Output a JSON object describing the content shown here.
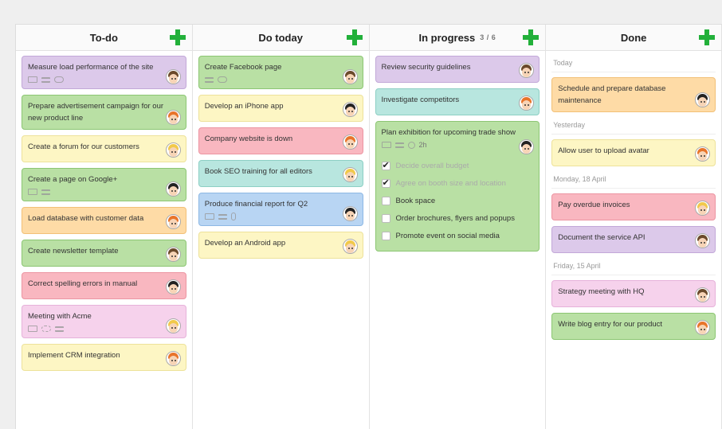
{
  "columns": [
    {
      "title": "To-do",
      "count": "",
      "cards": [
        {
          "title": "Measure load performance of the site",
          "color": "purple",
          "meta": [
            "note-icon",
            "checklist-icon",
            "comment-icon"
          ],
          "hair": "#6b4a2b"
        },
        {
          "title": "Prepare advertisement campaign for our new product line",
          "color": "green",
          "meta": [],
          "hair": "#e8742a"
        },
        {
          "title": "Create a forum for our customers",
          "color": "yellow",
          "meta": [],
          "hair": "#f1c94a"
        },
        {
          "title": "Create a page on Google+",
          "color": "green",
          "meta": [
            "note-icon",
            "checklist-icon"
          ],
          "hair": "#222222"
        },
        {
          "title": "Load database with customer data",
          "color": "orange",
          "meta": [],
          "hair": "#e8742a"
        },
        {
          "title": "Create newsletter template",
          "color": "green",
          "meta": [],
          "hair": "#6b4a2b"
        },
        {
          "title": "Correct spelling errors in manual",
          "color": "red",
          "meta": [],
          "hair": "#222222"
        },
        {
          "title": "Meeting with Acme",
          "color": "pink",
          "meta": [
            "note-icon",
            "repeat-icon",
            "checklist-icon"
          ],
          "hair": "#f1c94a"
        },
        {
          "title": "Implement CRM integration",
          "color": "yellow",
          "meta": [],
          "hair": "#e8742a"
        }
      ]
    },
    {
      "title": "Do today",
      "count": "",
      "cards": [
        {
          "title": "Create Facebook page",
          "color": "green",
          "meta": [
            "checklist-icon",
            "comment-icon"
          ],
          "hair": "#6b4a2b"
        },
        {
          "title": "Develop an iPhone app",
          "color": "yellow",
          "meta": [],
          "hair": "#222222"
        },
        {
          "title": "Company website is down",
          "color": "red",
          "meta": [],
          "hair": "#e8742a"
        },
        {
          "title": "Book SEO training for all editors",
          "color": "teal",
          "meta": [],
          "hair": "#f1c94a"
        },
        {
          "title": "Produce financial report for Q2",
          "color": "blue",
          "meta": [
            "note-icon",
            "checklist-icon",
            "attachment-icon"
          ],
          "hair": "#222222"
        },
        {
          "title": "Develop an Android app",
          "color": "yellow",
          "meta": [],
          "hair": "#f1c94a"
        }
      ]
    },
    {
      "title": "In progress",
      "count": "3 / 6",
      "cards": [
        {
          "title": "Review security guidelines",
          "color": "purple",
          "meta": [],
          "hair": "#6b4a2b"
        },
        {
          "title": "Investigate competitors",
          "color": "teal",
          "meta": [],
          "hair": "#e8742a"
        }
      ],
      "expanded": {
        "title": "Plan exhibition for upcoming trade show",
        "color": "green",
        "meta": [
          "note-icon",
          "checklist-icon"
        ],
        "duration": "2h",
        "hair": "#222222",
        "checklist": [
          {
            "label": "Decide overall budget",
            "checked": true
          },
          {
            "label": "Agree on booth size and location",
            "checked": true
          },
          {
            "label": "Book space",
            "checked": false
          },
          {
            "label": "Order brochures, flyers and popups",
            "checked": false
          },
          {
            "label": "Promote event on social media",
            "checked": false
          }
        ]
      }
    },
    {
      "title": "Done",
      "count": "",
      "groups": [
        {
          "label": "Today",
          "cards": [
            {
              "title": "Schedule and prepare database maintenance",
              "color": "orange",
              "meta": [],
              "hair": "#222222"
            }
          ]
        },
        {
          "label": "Yesterday",
          "cards": [
            {
              "title": "Allow user to upload avatar",
              "color": "yellow",
              "meta": [],
              "hair": "#e8742a"
            }
          ]
        },
        {
          "label": "Monday, 18 April",
          "cards": [
            {
              "title": "Pay overdue invoices",
              "color": "red",
              "meta": [],
              "hair": "#f1c94a"
            },
            {
              "title": "Document the service API",
              "color": "purple",
              "meta": [],
              "hair": "#6b4a2b"
            }
          ]
        },
        {
          "label": "Friday, 15 April",
          "cards": [
            {
              "title": "Strategy meeting with HQ",
              "color": "pink",
              "meta": [],
              "hair": "#6b4a2b"
            },
            {
              "title": "Write blog entry for our product",
              "color": "green",
              "meta": [],
              "hair": "#e8742a"
            }
          ]
        }
      ]
    }
  ]
}
